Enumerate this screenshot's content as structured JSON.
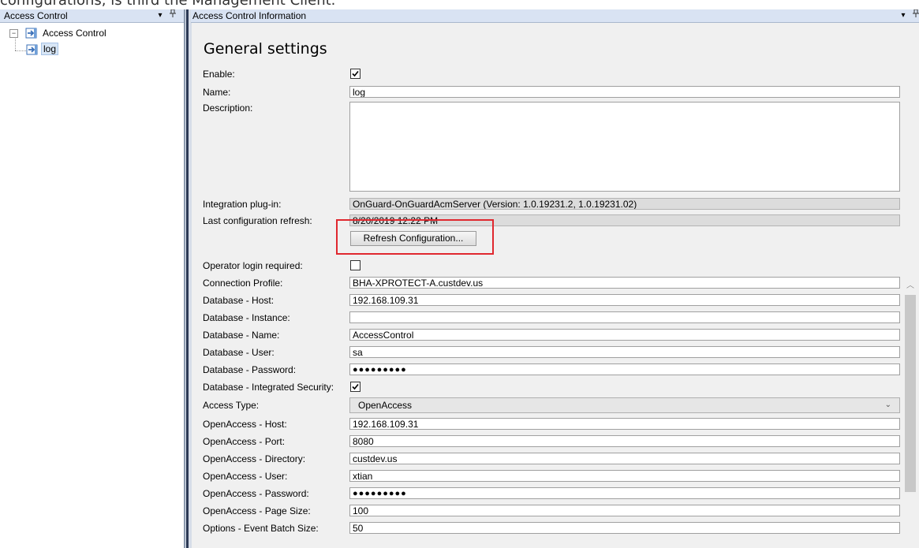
{
  "caption_text": "configurations, is third the Management Client.",
  "left_pane": {
    "title": "Access Control",
    "pin_glyph": "▾",
    "autohide_glyph": "ꟸ",
    "tree": {
      "root": {
        "label": "Access Control",
        "expander": "⊟",
        "icon": "access-control-icon"
      },
      "child": {
        "label": "log",
        "icon": "access-control-icon"
      }
    }
  },
  "right_pane": {
    "title": "Access Control Information",
    "pin_glyph": "▾",
    "autohide_glyph": "ꟸ"
  },
  "general": {
    "title": "General settings",
    "enable_label": "Enable:",
    "enable_checked": true,
    "name_label": "Name:",
    "name_value": "log",
    "description_label": "Description:",
    "description_value": "",
    "plugin_label": "Integration plug-in:",
    "plugin_value": "OnGuard-OnGuardAcmServer (Version: 1.0.19231.2, 1.0.19231.02)",
    "refresh_label": "Last configuration refresh:",
    "refresh_value": "8/20/2019 12:22 PM",
    "refresh_button": "Refresh Configuration..."
  },
  "settings": [
    {
      "label": "Operator login required:",
      "type": "checkbox",
      "checked": false
    },
    {
      "label": "Connection Profile:",
      "type": "text",
      "value": "BHA-XPROTECT-A.custdev.us"
    },
    {
      "label": "Database - Host:",
      "type": "text",
      "value": "192.168.109.31"
    },
    {
      "label": "Database - Instance:",
      "type": "text",
      "value": ""
    },
    {
      "label": "Database - Name:",
      "type": "text",
      "value": "AccessControl"
    },
    {
      "label": "Database - User:",
      "type": "text",
      "value": "sa"
    },
    {
      "label": "Database - Password:",
      "type": "password",
      "value": "●●●●●●●●●"
    },
    {
      "label": "Database - Integrated Security:",
      "type": "checkbox",
      "checked": true
    },
    {
      "label": "Access Type:",
      "type": "select",
      "value": "OpenAccess"
    },
    {
      "label": "OpenAccess - Host:",
      "type": "text",
      "value": "192.168.109.31"
    },
    {
      "label": "OpenAccess - Port:",
      "type": "text",
      "value": "8080"
    },
    {
      "label": "OpenAccess - Directory:",
      "type": "text",
      "value": "custdev.us"
    },
    {
      "label": "OpenAccess - User:",
      "type": "text",
      "value": "xtian"
    },
    {
      "label": "OpenAccess - Password:",
      "type": "password",
      "value": "●●●●●●●●●"
    },
    {
      "label": "OpenAccess - Page Size:",
      "type": "text",
      "value": "100"
    },
    {
      "label": "Options - Event Batch Size:",
      "type": "text",
      "value": "50"
    }
  ],
  "colors": {
    "highlight_box": "#e0282f",
    "header_bg": "#d9e3f3",
    "readonly_bg": "#dcdcdc"
  }
}
